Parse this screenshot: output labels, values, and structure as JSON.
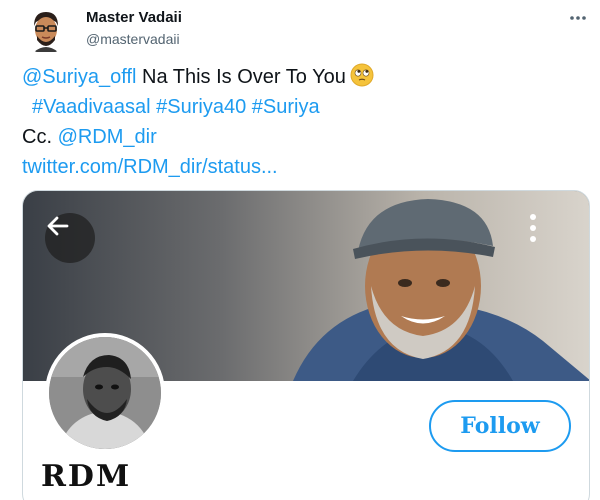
{
  "tweet": {
    "author_name": "Master Vadaii",
    "author_handle": "@mastervadaii",
    "lines": {
      "l1_mention": "@Suriya_offl",
      "l1_text": " Na This Is Over To You",
      "l2_tag1": "#Vaadivaasal",
      "l2_tag2": "#Suriya40",
      "l2_tag3": "#Suriya",
      "l3_prefix": "Cc. ",
      "l3_mention": "@RDM_dir",
      "l4_link": "twitter.com/RDM_dir/status..."
    }
  },
  "embed": {
    "profile_name": "RDM",
    "follow_label": "Follow"
  },
  "colors": {
    "link": "#1d9bf0",
    "text": "#0f1419",
    "muted": "#536471"
  },
  "icons": {
    "more_top": "more-horizontal-icon",
    "back": "back-arrow-icon",
    "menu": "more-vertical-icon",
    "emoji": "face-with-rolling-eyes-icon"
  }
}
